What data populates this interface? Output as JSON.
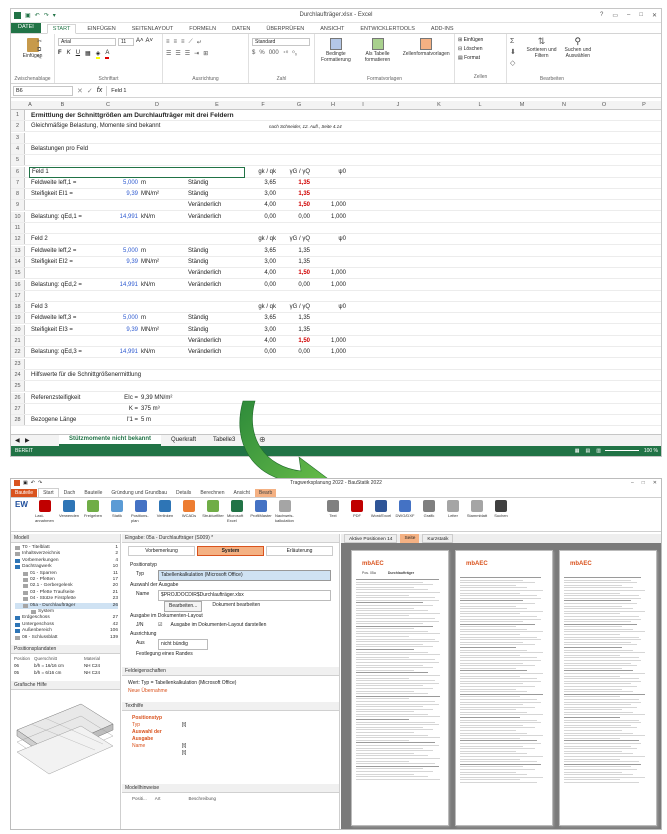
{
  "excel": {
    "title": "Durchlaufträger.xlsx - Excel",
    "window_controls": [
      "?",
      "▭",
      "–",
      "□",
      "✕"
    ],
    "tabs": [
      "DATEI",
      "START",
      "EINFÜGEN",
      "SEITENLAYOUT",
      "FORMELN",
      "DATEN",
      "ÜBERPRÜFEN",
      "ANSICHT",
      "ENTWICKLERTOOLS",
      "ADD-INS"
    ],
    "ribbon": {
      "paste": "Einfügen",
      "font_name": "Arial",
      "font_size": "11",
      "number_format": "Standard",
      "cond_format": "Bedingte Formatierung",
      "as_table": "Als Tabelle formatieren",
      "cell_styles": "Zellenformatvorlagen",
      "insert": "Einfügen",
      "delete": "Löschen",
      "format": "Format",
      "sort": "Sortieren und Filtern",
      "find": "Suchen und Auswählen",
      "groups": [
        "Zwischenablage",
        "Schriftart",
        "Ausrichtung",
        "Zahl",
        "Formatvorlagen",
        "Zellen",
        "Bearbeiten"
      ]
    },
    "name_box": "B6",
    "formula": "Feld 1",
    "columns": [
      "A",
      "B",
      "C",
      "D",
      "E",
      "F",
      "G",
      "H",
      "I",
      "J",
      "K",
      "L",
      "M",
      "N",
      "O",
      "P"
    ],
    "rows": [
      {
        "n": "1",
        "cells": {
          "b": "Ermittlung der Schnittgrößen am Durchlaufträger mit drei Feldern"
        }
      },
      {
        "n": "2",
        "cells": {
          "b": "Gleichmäßige Belastung, Momente sind bekannt",
          "g": "nach Schneider, 12. Aufl., Seite 4.14"
        }
      },
      {
        "n": "3",
        "cells": {}
      },
      {
        "n": "4",
        "cells": {
          "b": "Belastungen pro Feld"
        }
      },
      {
        "n": "5",
        "cells": {}
      },
      {
        "n": "6",
        "cells": {
          "b": "Feld 1",
          "f": "gk / qk",
          "g": "γG / γQ",
          "h": "ψ0"
        }
      },
      {
        "n": "7",
        "cells": {
          "b": "Feldweite  leff,1 =",
          "c": "5,000",
          "d": "m",
          "e": "Ständig",
          "f": "3,65",
          "g": "1,35"
        }
      },
      {
        "n": "8",
        "cells": {
          "b": "Steifigkeit EI1 =",
          "c": "9,39",
          "d": "MN/m²",
          "e": "Ständig",
          "f": "3,00",
          "g": "1,35"
        }
      },
      {
        "n": "9",
        "cells": {
          "e": "Veränderlich",
          "f": "4,00",
          "g": "1,50",
          "h": "1,000"
        }
      },
      {
        "n": "10",
        "cells": {
          "b": "Belastung: qEd,1 =",
          "c": "14,991",
          "d": "kN/m",
          "e": "Veränderlich",
          "f": "0,00",
          "g": "0,00",
          "h": "1,000"
        }
      },
      {
        "n": "11",
        "cells": {}
      },
      {
        "n": "12",
        "cells": {
          "b": "Feld 2",
          "f": "gk / qk",
          "g": "γG / γQ",
          "h": "ψ0"
        }
      },
      {
        "n": "13",
        "cells": {
          "b": "Feldweite  leff,2 =",
          "c": "5,000",
          "d": "m",
          "e": "Ständig",
          "f": "3,65",
          "g": "1,35"
        }
      },
      {
        "n": "14",
        "cells": {
          "b": "Steifigkeit EI2 =",
          "c": "9,39",
          "d": "MN/m²",
          "e": "Ständig",
          "f": "3,00",
          "g": "1,35"
        }
      },
      {
        "n": "15",
        "cells": {
          "e": "Veränderlich",
          "f": "4,00",
          "g": "1,50",
          "h": "1,000"
        }
      },
      {
        "n": "16",
        "cells": {
          "b": "Belastung: qEd,2 =",
          "c": "14,991",
          "d": "kN/m",
          "e": "Veränderlich",
          "f": "0,00",
          "g": "0,00",
          "h": "1,000"
        }
      },
      {
        "n": "17",
        "cells": {}
      },
      {
        "n": "18",
        "cells": {
          "b": "Feld 3",
          "f": "gk / qk",
          "g": "γG / γQ",
          "h": "ψ0"
        }
      },
      {
        "n": "19",
        "cells": {
          "b": "Feldweite  leff,3 =",
          "c": "5,000",
          "d": "m",
          "e": "Ständig",
          "f": "3,65",
          "g": "1,35"
        }
      },
      {
        "n": "20",
        "cells": {
          "b": "Steifigkeit EI3 =",
          "c": "9,39",
          "d": "MN/m²",
          "e": "Ständig",
          "f": "3,00",
          "g": "1,35"
        }
      },
      {
        "n": "21",
        "cells": {
          "e": "Veränderlich",
          "f": "4,00",
          "g": "1,50",
          "h": "1,000"
        }
      },
      {
        "n": "22",
        "cells": {
          "b": "Belastung: qEd,3 =",
          "c": "14,991",
          "d": "kN/m",
          "e": "Veränderlich",
          "f": "0,00",
          "g": "0,00",
          "h": "1,000"
        }
      },
      {
        "n": "23",
        "cells": {}
      },
      {
        "n": "24",
        "cells": {
          "b": "Hilfswerte für die Schnittgrößenermittlung"
        }
      },
      {
        "n": "25",
        "cells": {}
      },
      {
        "n": "26",
        "cells": {
          "b": "Referenzsteifigkeit",
          "c": "EIc =",
          "d": "9,39 MN/m²"
        }
      },
      {
        "n": "27",
        "cells": {
          "c": "K =",
          "d": "375 m³"
        }
      },
      {
        "n": "28",
        "cells": {
          "b": "Bezogene Länge",
          "c": "l'1 =",
          "d": "5 m"
        }
      }
    ],
    "sheet_tabs": [
      "Stützmomente nicht bekannt",
      "Querkraft",
      "Tabelle3"
    ],
    "status": "BEREIT",
    "zoom": "100 %"
  },
  "bauss": {
    "title": "Tragwerksplanung 2022 - BauStatik 2022",
    "tabs": [
      "Bauteile",
      "Start",
      "Dach",
      "Bauteile",
      "Gründung und Grundbau",
      "Details",
      "Berechnen",
      "Ansicht",
      "Bearb"
    ],
    "ribbon": [
      "EW",
      "Last-annahmen",
      "Verwenden",
      "Freigeben",
      "Statik",
      "Positions-plan",
      "Verlinken",
      "WCADs",
      "Strukturfilter",
      "Microsoft Excel",
      "ProfilMaster",
      "Nachweis-kalkulation",
      "Text",
      "PDF",
      "Word/Excel",
      "DWG/DXF",
      "Grafik",
      "Leiter",
      "Stammblatt",
      "Suchen"
    ],
    "model_panel": "Modell",
    "tree": [
      {
        "label": "T0 - Titelblatt",
        "page": "1"
      },
      {
        "label": "Inhaltsverzeichnis",
        "page": "2"
      },
      {
        "label": "Vorbemerkungen",
        "page": "4"
      },
      {
        "label": "Dachtragwerk",
        "page": "10"
      },
      {
        "label": "01 - Sparren",
        "page": "11"
      },
      {
        "label": "02 - Pfetten",
        "page": "17"
      },
      {
        "label": "02.1 - Gerbergelenk",
        "page": "20"
      },
      {
        "label": "03 - Pfette Traufseite",
        "page": "21"
      },
      {
        "label": "04 - Stütze Firstpfette",
        "page": "23"
      },
      {
        "label": "05a - Durchlaufträger",
        "page": "26"
      },
      {
        "label": "System",
        "page": ""
      },
      {
        "label": "Erdgeschoss",
        "page": "27"
      },
      {
        "label": "Untergeschoss",
        "page": "42"
      },
      {
        "label": "Außenbereich",
        "page": "106"
      },
      {
        "label": "08 - Schlussblatt",
        "page": "139"
      }
    ],
    "positions_panel": "Positionsplandaten",
    "positions_header": [
      "Position",
      "Querschnitt",
      "Material"
    ],
    "positions": [
      [
        "06",
        "b/h = 16/16 cm",
        "NH C24"
      ],
      [
        "05",
        "b/h = 6/16 cm",
        "NH C24"
      ]
    ],
    "graphic_panel": "Grafische Hilfe",
    "input_panel": "Eingabe: 05a - Durchlaufträger (S009) *",
    "input_tabs": [
      "Vorbemerkung",
      "System",
      "Erläuterung"
    ],
    "sections": {
      "positionstyp": "Positionstyp",
      "typ_label": "Typ",
      "typ_value": "Tabellenkalkulation (Microsoft Office)",
      "auswahl": "Auswahl der Ausgabe",
      "name_label": "Name",
      "name_value": "$PROJDOCDIR$Durchlaufträger.xlsx",
      "bearbeiten": "Bearbeiten...",
      "dokument": "Dokument bearbeiten",
      "layout": "Ausgabe im Dokumenten-Layout",
      "layout_checkbox": "Ausgabe im Dokumenten-Layout darstellen",
      "ja_nein": "J/N",
      "ausrichtung": "Ausrichtung",
      "aus_label": "Aus",
      "aus_value": "nicht bündig",
      "festlegung": "Festlegung eines Randes"
    },
    "field_props": "Feldeigenschaften",
    "field_text": "Wert: Typ = Tabellenkalkulation (Microsoft Office)",
    "field_new": "Neue Übernahme",
    "texthilfe": "Texthilfe",
    "tips": [
      [
        "Positionstyp",
        ""
      ],
      [
        "Typ",
        "[t]"
      ],
      [
        "Auswahl der Ausgabe",
        ""
      ],
      [
        "Name",
        "[t]"
      ],
      [
        "",
        "[t]"
      ]
    ],
    "model_hints": "Modellhinweise",
    "model_hints_header": [
      "Positi...",
      "Art",
      "Beschreibung"
    ],
    "doc_tabs": [
      "Aktive Positionen 14",
      "Seite",
      "Kurzstatik"
    ],
    "doc_title": "Durchlaufträger",
    "doc_pos": "Pos. 05a",
    "logo": "mbAEC"
  }
}
